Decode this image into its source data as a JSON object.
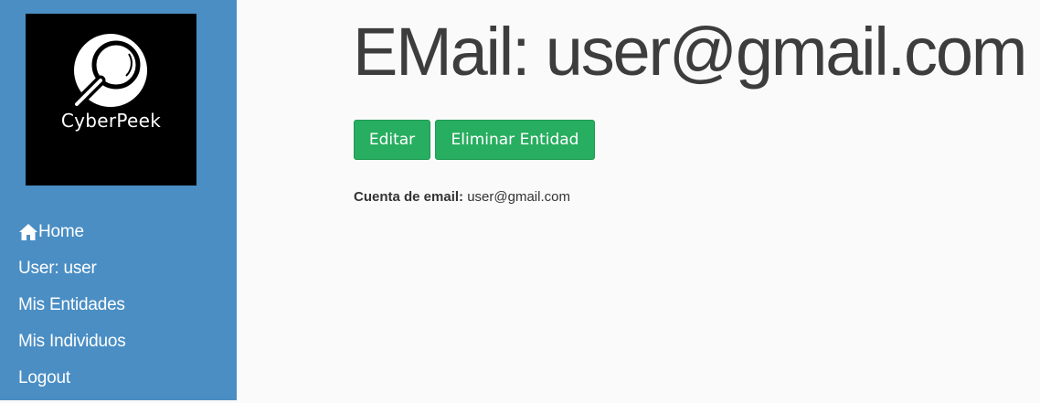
{
  "sidebar": {
    "logo_text": "CyberPeek",
    "items": [
      {
        "label": "Home",
        "icon": "home-icon"
      },
      {
        "label": "User: user"
      },
      {
        "label": "Mis Entidades"
      },
      {
        "label": "Mis Individuos"
      },
      {
        "label": "Logout"
      }
    ]
  },
  "main": {
    "title": "EMail: user@gmail.com",
    "buttons": {
      "edit_label": "Editar",
      "delete_label": "Eliminar Entidad"
    },
    "field": {
      "label": "Cuenta de email:",
      "value": "user@gmail.com"
    }
  },
  "colors": {
    "sidebar_bg": "#4a8ec4",
    "button_bg": "#27ae60",
    "title_color": "#3d3d3d"
  }
}
